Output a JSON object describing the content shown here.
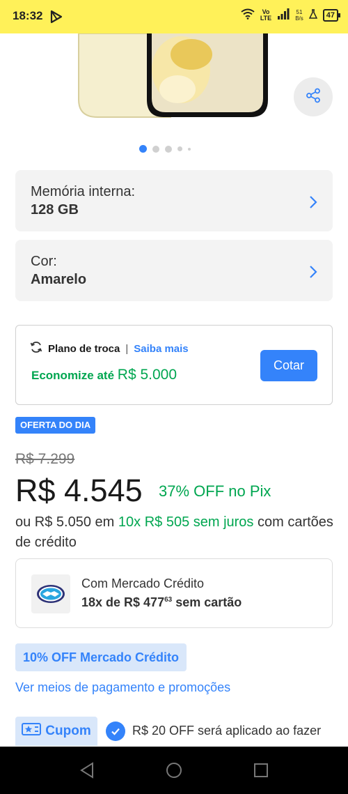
{
  "status_bar": {
    "time": "18:32",
    "volte_top": "Vo",
    "volte_bottom": "LTE",
    "speed_value": "51",
    "speed_unit": "B/s",
    "battery": "47"
  },
  "gallery": {
    "image_icon": "phone-product-image",
    "share_icon": "share-icon",
    "active_index": 1,
    "total": 5
  },
  "options": [
    {
      "label": "Memória interna:",
      "value": "128 GB"
    },
    {
      "label": "Cor:",
      "value": "Amarelo"
    }
  ],
  "trade_in": {
    "title": "Plano de troca",
    "separator": "|",
    "link": "Saiba mais",
    "save_label": "Economize até",
    "save_amount": "R$ 5.000",
    "button": "Cotar"
  },
  "pricing": {
    "badge": "OFERTA DO DIA",
    "old_price": "R$ 7.299",
    "price": "R$ 4.545",
    "discount": "37% OFF no Pix",
    "install_prefix": "ou R$ 5.050 em",
    "install_highlight": "10x R$ 505 sem juros",
    "install_suffix": "com cartões de crédito"
  },
  "credit": {
    "title": "Com Mercado Crédito",
    "line_prefix": "18x de R$ 477",
    "line_cents": "63",
    "line_suffix": "sem cartão"
  },
  "promo_badge": "10% OFF Mercado Crédito",
  "payment_link": "Ver meios de pagamento e promoções",
  "coupon": {
    "label": "Cupom",
    "text": "R$ 20 OFF será aplicado ao fazer"
  },
  "colors": {
    "accent": "#3483fa",
    "green": "#00a650",
    "status_bar": "#fff159"
  }
}
